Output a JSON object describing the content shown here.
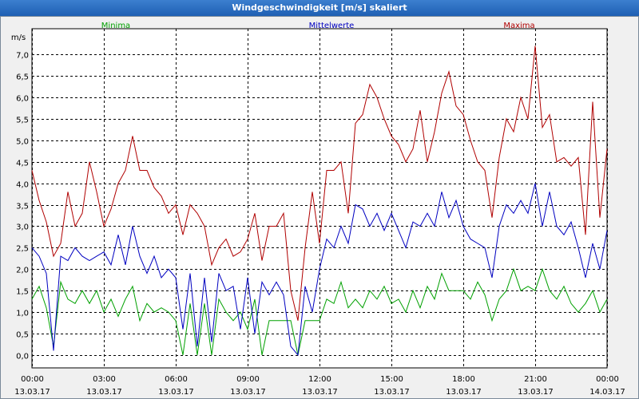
{
  "window": {
    "title": "Windgeschwindigkeit [m/s] skaliert"
  },
  "chart_data": {
    "type": "line",
    "title": "Windgeschwindigkeit [m/s] skaliert",
    "ylabel": "m/s",
    "xlabel": "",
    "grid": true,
    "ylim": [
      -0.3,
      7.6
    ],
    "yticks": [
      "0,0",
      "0,5",
      "1,0",
      "1,5",
      "2,0",
      "2,5",
      "3,0",
      "3,5",
      "4,0",
      "4,5",
      "5,0",
      "5,5",
      "6,0",
      "6,5",
      "7,0"
    ],
    "xlim": [
      0,
      24
    ],
    "xticks": [
      {
        "time": "00:00",
        "date": "13.03.17"
      },
      {
        "time": "03:00",
        "date": "13.03.17"
      },
      {
        "time": "06:00",
        "date": "13.03.17"
      },
      {
        "time": "09:00",
        "date": "13.03.17"
      },
      {
        "time": "12:00",
        "date": "13.03.17"
      },
      {
        "time": "15:00",
        "date": "13.03.17"
      },
      {
        "time": "18:00",
        "date": "13.03.17"
      },
      {
        "time": "21:00",
        "date": "13.03.17"
      },
      {
        "time": "00:00",
        "date": "14.03.17"
      }
    ],
    "legend_placement": "top",
    "series": [
      {
        "name": "Minima",
        "color": "#00a000",
        "legend_position": "left",
        "values": [
          [
            0.0,
            1.3
          ],
          [
            0.3,
            1.6
          ],
          [
            0.6,
            1.1
          ],
          [
            0.9,
            0.2
          ],
          [
            1.2,
            1.7
          ],
          [
            1.5,
            1.3
          ],
          [
            1.8,
            1.2
          ],
          [
            2.1,
            1.5
          ],
          [
            2.4,
            1.2
          ],
          [
            2.7,
            1.5
          ],
          [
            3.0,
            1.0
          ],
          [
            3.3,
            1.3
          ],
          [
            3.6,
            0.9
          ],
          [
            3.9,
            1.3
          ],
          [
            4.2,
            1.6
          ],
          [
            4.5,
            0.8
          ],
          [
            4.8,
            1.2
          ],
          [
            5.1,
            1.0
          ],
          [
            5.4,
            1.1
          ],
          [
            5.7,
            1.0
          ],
          [
            6.0,
            0.8
          ],
          [
            6.3,
            0.0
          ],
          [
            6.6,
            1.2
          ],
          [
            6.9,
            0.0
          ],
          [
            7.2,
            1.2
          ],
          [
            7.5,
            0.0
          ],
          [
            7.8,
            1.3
          ],
          [
            8.1,
            1.0
          ],
          [
            8.4,
            0.8
          ],
          [
            8.7,
            1.0
          ],
          [
            9.0,
            0.6
          ],
          [
            9.3,
            1.3
          ],
          [
            9.6,
            0.0
          ],
          [
            9.9,
            0.8
          ],
          [
            10.2,
            0.8
          ],
          [
            10.5,
            0.8
          ],
          [
            10.8,
            0.8
          ],
          [
            11.1,
            0.0
          ],
          [
            11.4,
            0.8
          ],
          [
            11.7,
            0.8
          ],
          [
            12.0,
            0.8
          ],
          [
            12.3,
            1.3
          ],
          [
            12.6,
            1.2
          ],
          [
            12.9,
            1.7
          ],
          [
            13.2,
            1.1
          ],
          [
            13.5,
            1.3
          ],
          [
            13.8,
            1.1
          ],
          [
            14.1,
            1.5
          ],
          [
            14.4,
            1.3
          ],
          [
            14.7,
            1.6
          ],
          [
            15.0,
            1.2
          ],
          [
            15.3,
            1.3
          ],
          [
            15.6,
            1.0
          ],
          [
            15.9,
            1.5
          ],
          [
            16.2,
            1.1
          ],
          [
            16.5,
            1.6
          ],
          [
            16.8,
            1.3
          ],
          [
            17.1,
            1.9
          ],
          [
            17.4,
            1.5
          ],
          [
            17.7,
            1.5
          ],
          [
            18.0,
            1.5
          ],
          [
            18.3,
            1.3
          ],
          [
            18.6,
            1.7
          ],
          [
            18.9,
            1.4
          ],
          [
            19.2,
            0.8
          ],
          [
            19.5,
            1.3
          ],
          [
            19.8,
            1.5
          ],
          [
            20.1,
            2.0
          ],
          [
            20.4,
            1.5
          ],
          [
            20.7,
            1.6
          ],
          [
            21.0,
            1.5
          ],
          [
            21.3,
            2.0
          ],
          [
            21.6,
            1.5
          ],
          [
            21.9,
            1.3
          ],
          [
            22.2,
            1.6
          ],
          [
            22.5,
            1.2
          ],
          [
            22.8,
            1.0
          ],
          [
            23.1,
            1.2
          ],
          [
            23.4,
            1.5
          ],
          [
            23.7,
            1.0
          ],
          [
            24.0,
            1.3
          ]
        ]
      },
      {
        "name": "Mittelwerte",
        "color": "#0000c0",
        "legend_position": "center",
        "values": [
          [
            0.0,
            2.5
          ],
          [
            0.3,
            2.3
          ],
          [
            0.6,
            1.9
          ],
          [
            0.9,
            0.1
          ],
          [
            1.2,
            2.3
          ],
          [
            1.5,
            2.2
          ],
          [
            1.8,
            2.5
          ],
          [
            2.1,
            2.3
          ],
          [
            2.4,
            2.2
          ],
          [
            2.7,
            2.3
          ],
          [
            3.0,
            2.4
          ],
          [
            3.3,
            2.1
          ],
          [
            3.6,
            2.8
          ],
          [
            3.9,
            2.1
          ],
          [
            4.2,
            3.0
          ],
          [
            4.5,
            2.3
          ],
          [
            4.8,
            1.9
          ],
          [
            5.1,
            2.3
          ],
          [
            5.4,
            1.8
          ],
          [
            5.7,
            2.0
          ],
          [
            6.0,
            1.8
          ],
          [
            6.3,
            0.6
          ],
          [
            6.6,
            1.9
          ],
          [
            6.9,
            0.2
          ],
          [
            7.2,
            1.8
          ],
          [
            7.5,
            0.3
          ],
          [
            7.8,
            1.9
          ],
          [
            8.1,
            1.5
          ],
          [
            8.4,
            1.6
          ],
          [
            8.7,
            0.6
          ],
          [
            9.0,
            1.8
          ],
          [
            9.3,
            0.5
          ],
          [
            9.6,
            1.7
          ],
          [
            9.9,
            1.4
          ],
          [
            10.2,
            1.7
          ],
          [
            10.5,
            1.4
          ],
          [
            10.8,
            0.2
          ],
          [
            11.1,
            0.0
          ],
          [
            11.4,
            1.6
          ],
          [
            11.7,
            1.0
          ],
          [
            12.0,
            2.0
          ],
          [
            12.3,
            2.7
          ],
          [
            12.6,
            2.5
          ],
          [
            12.9,
            3.0
          ],
          [
            13.2,
            2.6
          ],
          [
            13.5,
            3.5
          ],
          [
            13.8,
            3.4
          ],
          [
            14.1,
            3.0
          ],
          [
            14.4,
            3.3
          ],
          [
            14.7,
            2.9
          ],
          [
            15.0,
            3.3
          ],
          [
            15.3,
            2.9
          ],
          [
            15.6,
            2.5
          ],
          [
            15.9,
            3.1
          ],
          [
            16.2,
            3.0
          ],
          [
            16.5,
            3.3
          ],
          [
            16.8,
            3.0
          ],
          [
            17.1,
            3.8
          ],
          [
            17.4,
            3.2
          ],
          [
            17.7,
            3.6
          ],
          [
            18.0,
            3.0
          ],
          [
            18.3,
            2.7
          ],
          [
            18.6,
            2.6
          ],
          [
            18.9,
            2.5
          ],
          [
            19.2,
            1.8
          ],
          [
            19.5,
            3.0
          ],
          [
            19.8,
            3.5
          ],
          [
            20.1,
            3.3
          ],
          [
            20.4,
            3.6
          ],
          [
            20.7,
            3.3
          ],
          [
            21.0,
            4.0
          ],
          [
            21.3,
            3.0
          ],
          [
            21.6,
            3.8
          ],
          [
            21.9,
            3.0
          ],
          [
            22.2,
            2.8
          ],
          [
            22.5,
            3.1
          ],
          [
            22.8,
            2.5
          ],
          [
            23.1,
            1.8
          ],
          [
            23.4,
            2.6
          ],
          [
            23.7,
            2.0
          ],
          [
            24.0,
            2.9
          ]
        ]
      },
      {
        "name": "Maxima",
        "color": "#b00000",
        "legend_position": "right",
        "values": [
          [
            0.0,
            4.3
          ],
          [
            0.3,
            3.6
          ],
          [
            0.6,
            3.1
          ],
          [
            0.9,
            2.3
          ],
          [
            1.2,
            2.6
          ],
          [
            1.5,
            3.8
          ],
          [
            1.8,
            3.0
          ],
          [
            2.1,
            3.3
          ],
          [
            2.4,
            4.5
          ],
          [
            2.7,
            3.8
          ],
          [
            3.0,
            3.0
          ],
          [
            3.3,
            3.4
          ],
          [
            3.6,
            4.0
          ],
          [
            3.9,
            4.3
          ],
          [
            4.2,
            5.1
          ],
          [
            4.5,
            4.3
          ],
          [
            4.8,
            4.3
          ],
          [
            5.1,
            3.9
          ],
          [
            5.4,
            3.7
          ],
          [
            5.7,
            3.3
          ],
          [
            6.0,
            3.5
          ],
          [
            6.3,
            2.8
          ],
          [
            6.6,
            3.5
          ],
          [
            6.9,
            3.3
          ],
          [
            7.2,
            3.0
          ],
          [
            7.5,
            2.1
          ],
          [
            7.8,
            2.5
          ],
          [
            8.1,
            2.7
          ],
          [
            8.4,
            2.3
          ],
          [
            8.7,
            2.4
          ],
          [
            9.0,
            2.7
          ],
          [
            9.3,
            3.3
          ],
          [
            9.6,
            2.2
          ],
          [
            9.9,
            3.0
          ],
          [
            10.2,
            3.0
          ],
          [
            10.5,
            3.3
          ],
          [
            10.8,
            1.5
          ],
          [
            11.1,
            0.8
          ],
          [
            11.4,
            2.5
          ],
          [
            11.7,
            3.8
          ],
          [
            12.0,
            2.6
          ],
          [
            12.3,
            4.3
          ],
          [
            12.6,
            4.3
          ],
          [
            12.9,
            4.5
          ],
          [
            13.2,
            3.3
          ],
          [
            13.5,
            5.4
          ],
          [
            13.8,
            5.6
          ],
          [
            14.1,
            6.3
          ],
          [
            14.4,
            6.0
          ],
          [
            14.7,
            5.5
          ],
          [
            15.0,
            5.1
          ],
          [
            15.3,
            4.9
          ],
          [
            15.6,
            4.5
          ],
          [
            15.9,
            4.8
          ],
          [
            16.2,
            5.7
          ],
          [
            16.5,
            4.5
          ],
          [
            16.8,
            5.2
          ],
          [
            17.1,
            6.1
          ],
          [
            17.4,
            6.6
          ],
          [
            17.7,
            5.8
          ],
          [
            18.0,
            5.6
          ],
          [
            18.3,
            5.0
          ],
          [
            18.6,
            4.5
          ],
          [
            18.9,
            4.3
          ],
          [
            19.2,
            3.2
          ],
          [
            19.5,
            4.6
          ],
          [
            19.8,
            5.5
          ],
          [
            20.1,
            5.2
          ],
          [
            20.4,
            6.0
          ],
          [
            20.7,
            5.5
          ],
          [
            21.0,
            7.2
          ],
          [
            21.3,
            5.3
          ],
          [
            21.6,
            5.6
          ],
          [
            21.9,
            4.5
          ],
          [
            22.2,
            4.6
          ],
          [
            22.5,
            4.4
          ],
          [
            22.8,
            4.6
          ],
          [
            23.1,
            2.8
          ],
          [
            23.4,
            5.9
          ],
          [
            23.7,
            3.2
          ],
          [
            24.0,
            4.8
          ]
        ]
      }
    ]
  }
}
